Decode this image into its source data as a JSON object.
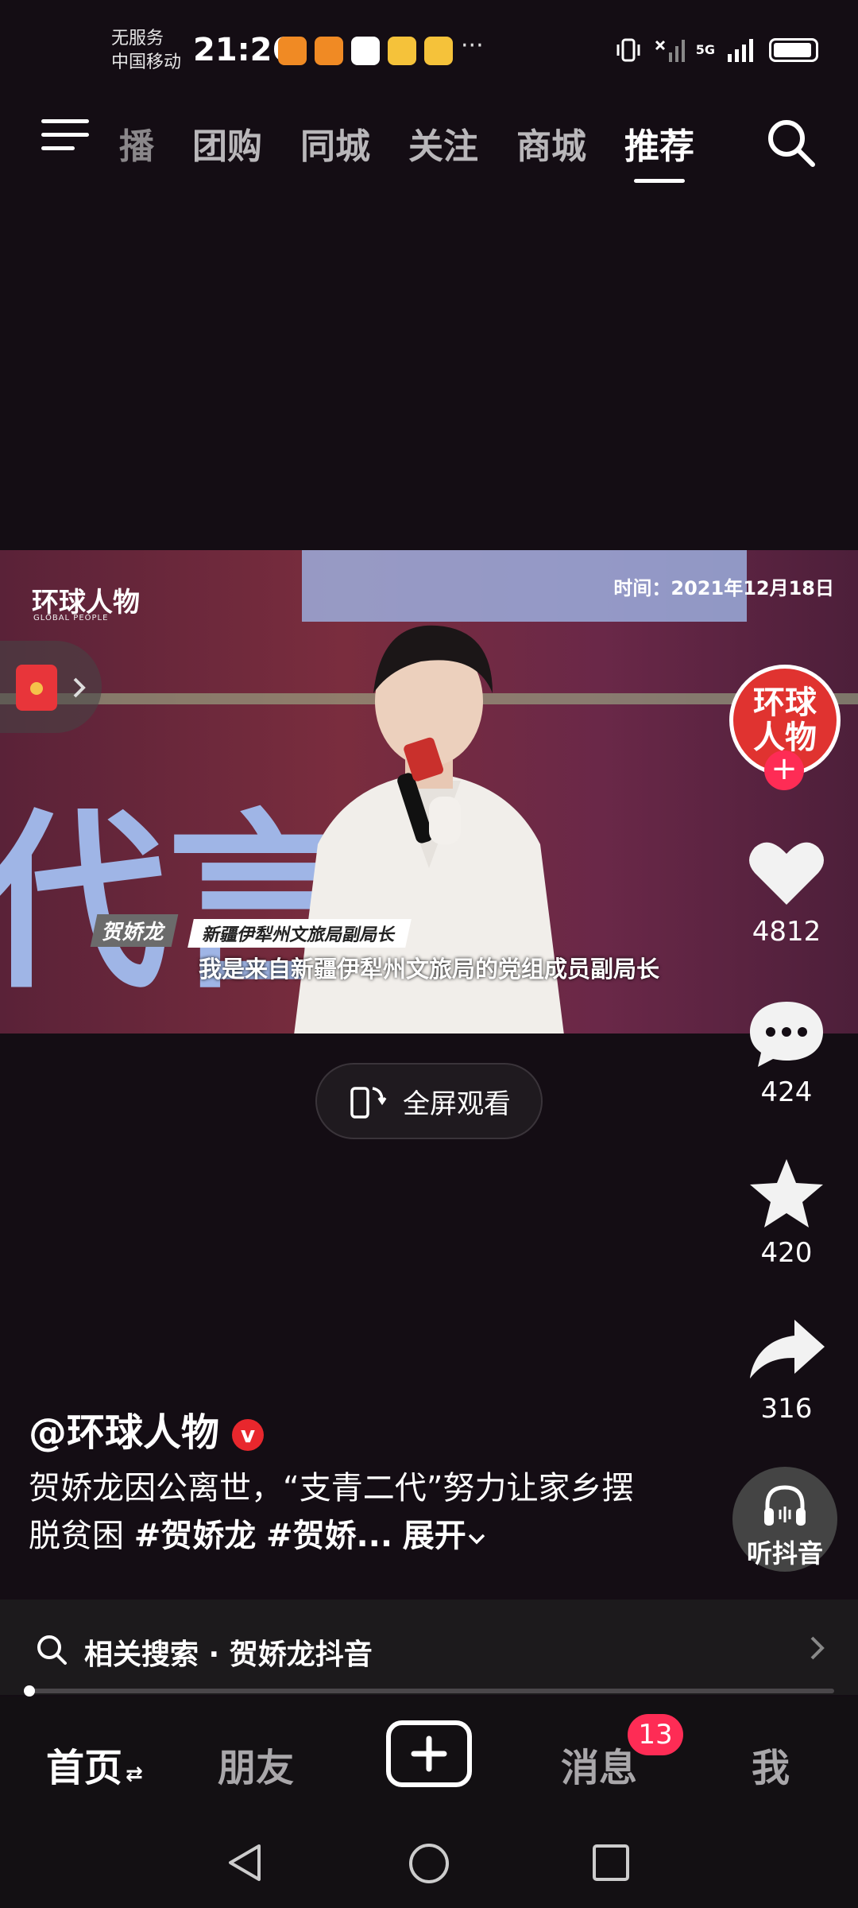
{
  "status_bar": {
    "carrier_line1": "无服务",
    "carrier_line2": "中国移动",
    "time": "21:26",
    "more": "···",
    "network": "5G"
  },
  "top_nav": {
    "tabs": [
      "播",
      "团购",
      "同城",
      "关注",
      "商城",
      "推荐"
    ],
    "active_tab": "推荐"
  },
  "video": {
    "watermark_logo": "环球人物",
    "watermark_sub": "GLOBAL PEOPLE",
    "date_label": "时间：2021年12月18日",
    "background_text": "代言",
    "name_tag": "贺娇龙",
    "title_tag": "新疆伊犁州文旅局副局长",
    "subtitle": "我是来自新疆伊犁州文旅局的党组成员副局长"
  },
  "fullscreen_label": "全屏观看",
  "rail": {
    "avatar_text": "环球人物",
    "follow": "+",
    "likes": "4812",
    "comments": "424",
    "favorites": "420",
    "shares": "316",
    "listen_label": "听抖音"
  },
  "post": {
    "author": "@环球人物",
    "verified_mark": "v",
    "caption_text": "贺娇龙因公离世，“支青二代”努力让家乡摆脱贫困 ",
    "hashtag1": "#贺娇龙",
    "hashtag2": "#贺娇...",
    "expand": "展开"
  },
  "related_search": {
    "label": "相关搜索 · 贺娇龙抖音"
  },
  "bottom_nav": {
    "home": "首页",
    "home_switch": "⇄",
    "friends": "朋友",
    "messages": "消息",
    "messages_badge": "13",
    "me": "我"
  },
  "colors": {
    "background": "#140d14",
    "accent": "#fe2c55",
    "avatar_red": "#e03330"
  }
}
